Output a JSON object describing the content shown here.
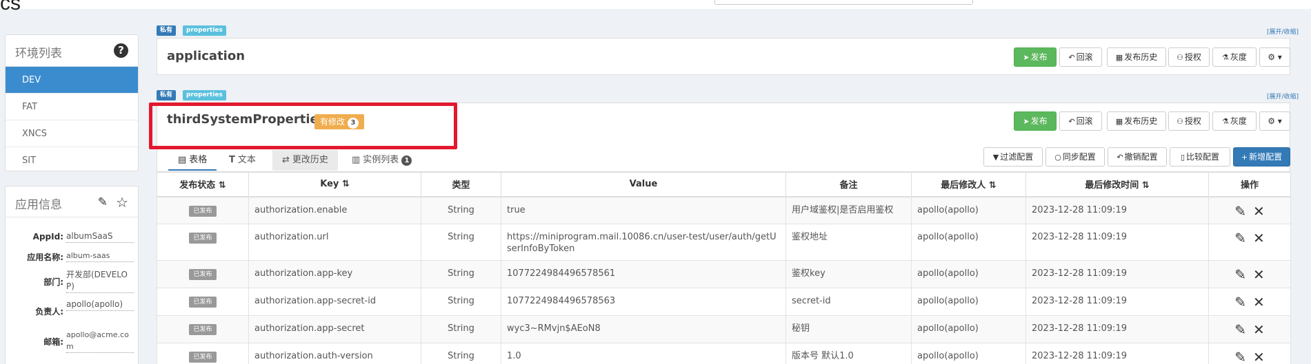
{
  "topbar": {
    "logo": "cs"
  },
  "env_panel": {
    "title": "环境列表",
    "help_icon": "question-circle-icon",
    "items": [
      "DEV",
      "FAT",
      "XNCS",
      "SIT"
    ],
    "active": "DEV"
  },
  "app_panel": {
    "title": "应用信息",
    "edit_icon": "edit-icon",
    "star_icon": "star-icon",
    "fields": [
      {
        "label": "AppId:",
        "value": "albumSaaS"
      },
      {
        "label": "应用名称:",
        "value": "album-saas"
      },
      {
        "label": "部门:",
        "value": "开发部(DEVELOP)"
      },
      {
        "label": "负责人:",
        "value": "apollo(apollo)"
      },
      {
        "label": "邮箱:",
        "value": "apollo@acme.com"
      }
    ]
  },
  "namespaces": [
    {
      "tag_private": "私有",
      "tag_format": "properties",
      "expand": "[展开/收缩]",
      "name": "application"
    },
    {
      "tag_private": "私有",
      "tag_format": "properties",
      "expand": "[展开/收缩]",
      "name": "thirdSystemProperties",
      "modified_label": "有修改",
      "modified_count": "3"
    }
  ],
  "actions": {
    "publish": "发布",
    "rollback": "回滚",
    "history": "发布历史",
    "grant": "授权",
    "gray": "灰度",
    "settings_icon": "gear-icon"
  },
  "tabs": [
    {
      "label": "表格",
      "icon": "table-icon"
    },
    {
      "label": "文本",
      "icon": "text-icon"
    },
    {
      "label": "更改历史",
      "icon": "history-icon"
    },
    {
      "label": "实例列表",
      "icon": "instance-icon",
      "count": "1"
    }
  ],
  "toolbar": {
    "filter": "过滤配置",
    "sync": "同步配置",
    "revoke": "撤销配置",
    "compare": "比较配置",
    "add": "新增配置"
  },
  "table": {
    "headers": [
      "发布状态 ⇅",
      "Key ⇅",
      "类型",
      "Value",
      "备注",
      "最后修改人 ⇅",
      "最后修改时间 ⇅",
      "操作"
    ],
    "rows": [
      {
        "status": "已发布",
        "key": "authorization.enable",
        "type": "String",
        "value": "true",
        "comment": "用户域鉴权|是否启用鉴权",
        "modifier": "apollo(apollo)",
        "time": "2023-12-28 11:09:19"
      },
      {
        "status": "已发布",
        "key": "authorization.url",
        "type": "String",
        "value": "https://miniprogram.mail.10086.cn/user-test/user/auth/getUserInfoByToken",
        "comment": "鉴权地址",
        "modifier": "apollo(apollo)",
        "time": "2023-12-28 11:09:19"
      },
      {
        "status": "已发布",
        "key": "authorization.app-key",
        "type": "String",
        "value": "1077224984496578561",
        "comment": "鉴权key",
        "modifier": "apollo(apollo)",
        "time": "2023-12-28 11:09:19"
      },
      {
        "status": "已发布",
        "key": "authorization.app-secret-id",
        "type": "String",
        "value": "1077224984496578563",
        "comment": "secret-id",
        "modifier": "apollo(apollo)",
        "time": "2023-12-28 11:09:19"
      },
      {
        "status": "已发布",
        "key": "authorization.app-secret",
        "type": "String",
        "value": "wyc3~RMvjn$AEoN8",
        "comment": "秘钥",
        "modifier": "apollo(apollo)",
        "time": "2023-12-28 11:09:19"
      },
      {
        "status": "已发布",
        "key": "authorization.auth-version",
        "type": "String",
        "value": "1.0",
        "comment": "版本号 默认1.0",
        "modifier": "apollo(apollo)",
        "time": "2023-12-28 11:09:19"
      }
    ]
  }
}
